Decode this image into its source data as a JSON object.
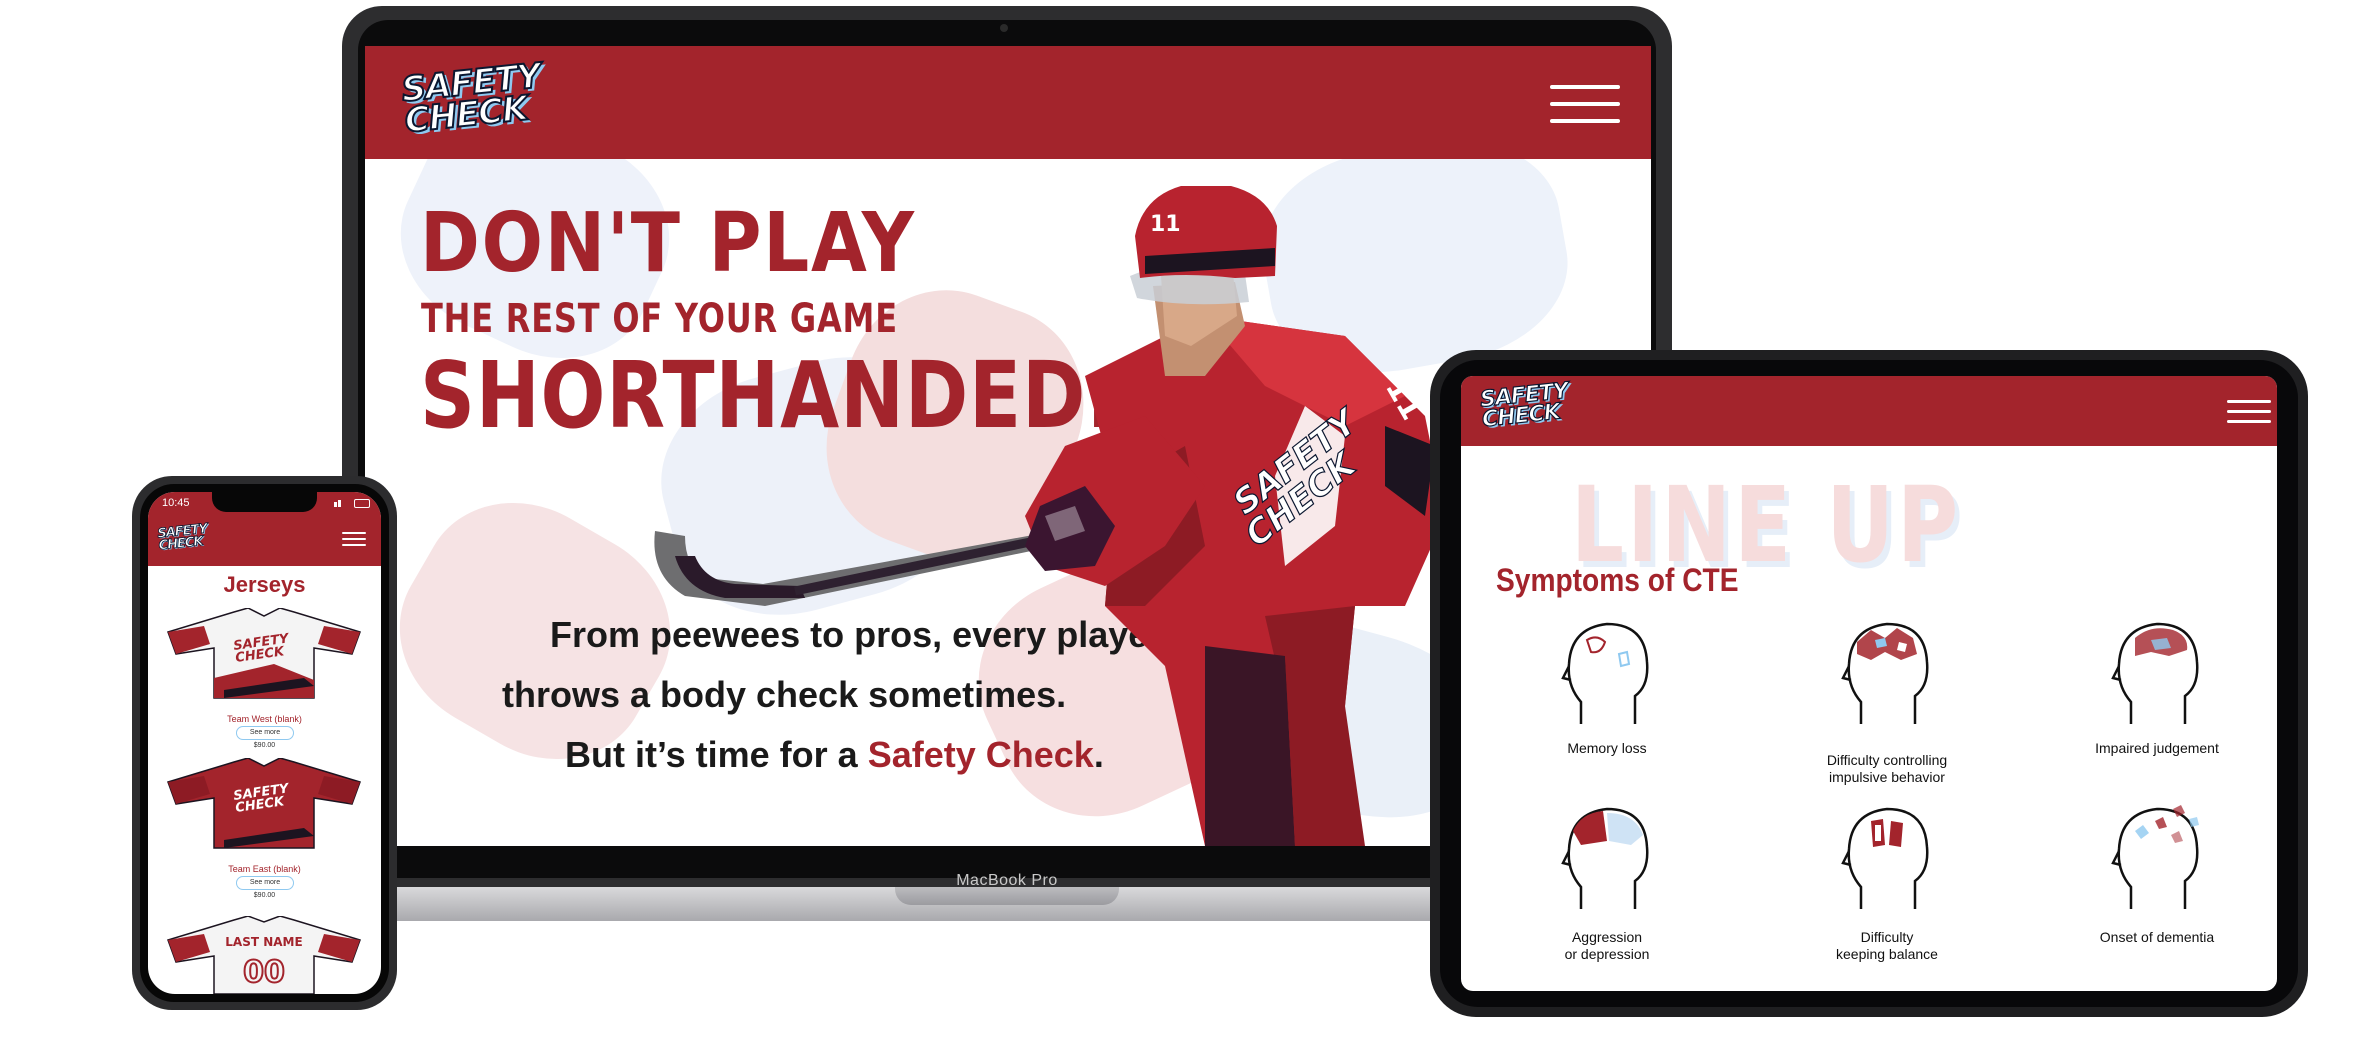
{
  "laptop": {
    "device_label": "MacBook Pro",
    "site": {
      "logo_line1": "SAFETY",
      "logo_line2": "CHECK",
      "headline_line1": "DON'T PLAY",
      "headline_line2": "THE REST OF YOUR GAME",
      "headline_line3": "SHORTHANDED.",
      "body_line1": "From peewees to pros, every player",
      "body_line2": "throws a body check sometimes.",
      "body_line3_prefix": "But it’s time for a ",
      "body_line3_highlight": "Safety Check",
      "body_line3_suffix": ".",
      "player_number": "11"
    }
  },
  "tablet": {
    "logo_line1": "SAFETY",
    "logo_line2": "CHECK",
    "bg_title": "LINE UP",
    "section_title": "Symptoms of CTE",
    "symptoms": [
      {
        "label_line1": "Memory loss",
        "label_line2": ""
      },
      {
        "label_line1": "Difficulty controlling",
        "label_line2": "impulsive behavior"
      },
      {
        "label_line1": "Impaired judgement",
        "label_line2": ""
      },
      {
        "label_line1": "Aggression",
        "label_line2": "or depression"
      },
      {
        "label_line1": "Difficulty",
        "label_line2": "keeping balance"
      },
      {
        "label_line1": "Onset of dementia",
        "label_line2": ""
      }
    ]
  },
  "phone": {
    "time": "10:45",
    "logo_line1": "SAFETY",
    "logo_line2": "CHECK",
    "page_title": "Jerseys",
    "products": [
      {
        "name": "Team West (blank)",
        "button": "See more",
        "price": "$90.00",
        "jersey_color": "white"
      },
      {
        "name": "Team East (blank)",
        "button": "See more",
        "price": "$90.00",
        "jersey_color": "red"
      },
      {
        "name_on_jersey": "LAST NAME",
        "number_on_jersey": "00",
        "jersey_color": "white"
      }
    ]
  },
  "colors": {
    "brand_red": "#a3242c",
    "accent_blue": "#8fc9f0",
    "navy": "#0b1730"
  }
}
